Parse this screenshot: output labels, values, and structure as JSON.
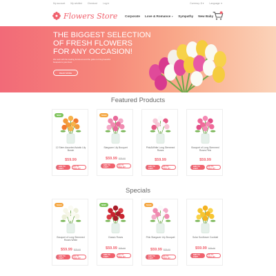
{
  "topbar": {
    "links": [
      "My account",
      "My wishlist",
      "Checkout",
      "Log in"
    ],
    "currency": "Currency: $ ▾",
    "language": "Language: ▾"
  },
  "header": {
    "logo": "Flowers Store",
    "nav": [
      "Corporate",
      "Love & Romance",
      "Sympathy",
      "New Baby"
    ]
  },
  "hero": {
    "title": "THE BIGGEST SELECTION\nOF FRESH FLOWERS\nFOR ANY OCCASION!",
    "text": "We work with the leading florists around the globe to bring beautiful bouquets to your door.",
    "button": "READ MORE"
  },
  "featured": {
    "title": "Featured Products",
    "products": [
      {
        "name": "12 Stem Assorted Asiatic Lily Bunch",
        "price": "$59.99",
        "old": "",
        "badge": "new"
      },
      {
        "name": "Stargazer Lily Bouquet",
        "price": "$59.99",
        "old": "$75.00",
        "badge": "sale"
      },
      {
        "name": "Pink&White Long Stemmed Roses",
        "price": "$59.99",
        "old": "",
        "badge": ""
      },
      {
        "name": "Bouquet of Long Stemmed Roses Pink",
        "price": "$59.99",
        "old": "",
        "badge": ""
      }
    ],
    "add_label": "ADD TO CART",
    "wish_label": "ADD TO WISHLIST"
  },
  "specials": {
    "title": "Specials",
    "products": [
      {
        "name": "Bouquet of Long Stemmed Roses White",
        "price": "$59.99",
        "old": "$75.00",
        "badge": "sale"
      },
      {
        "name": "Classic Roses",
        "price": "$59.99",
        "old": "$75.00",
        "badge": "new"
      },
      {
        "name": "Pink Stargazer Lily Bouquet",
        "price": "$59.99",
        "old": "$75.00",
        "badge": "sale"
      },
      {
        "name": "Solar Sunflower Cocktail",
        "price": "$59.99",
        "old": "$75.00",
        "badge": ""
      }
    ],
    "add_label": "ADD TO CART",
    "wish_label": "ADD TO WISHLIST"
  },
  "badges": {
    "new": "NEW",
    "sale": "SALE"
  },
  "colors": {
    "accent": "#f0616d",
    "badge_new": "#7dc35a",
    "badge_sale": "#f4a641"
  }
}
